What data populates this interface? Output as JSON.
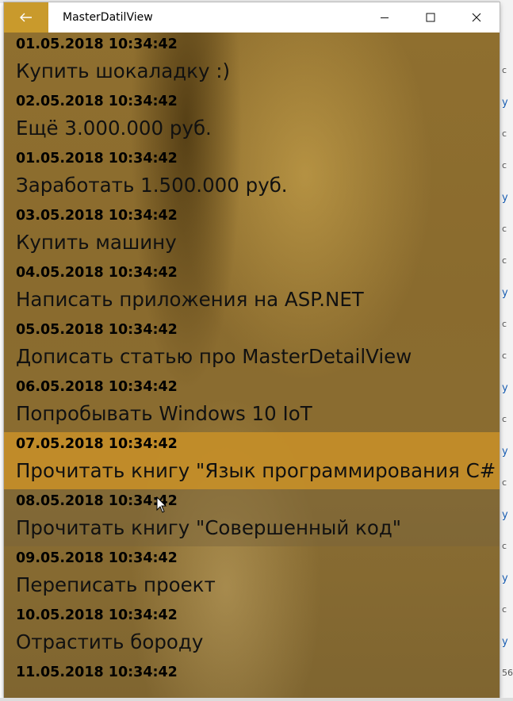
{
  "window": {
    "title": "MasterDatilView",
    "back_glyph": "←",
    "minimize_glyph": "—",
    "close_glyph": "✕"
  },
  "items": [
    {
      "date": "01.05.2018 10:34:42",
      "title": "Купить шокаладку :)"
    },
    {
      "date": "02.05.2018 10:34:42",
      "title": "Ещё 3.000.000 руб."
    },
    {
      "date": "01.05.2018 10:34:42",
      "title": "Заработать 1.500.000 руб."
    },
    {
      "date": "03.05.2018 10:34:42",
      "title": "Купить машину"
    },
    {
      "date": "04.05.2018 10:34:42",
      "title": "Написать приложения на ASP.NET"
    },
    {
      "date": "05.05.2018 10:34:42",
      "title": "Дописать статью про MasterDetailView"
    },
    {
      "date": "06.05.2018 10:34:42",
      "title": "Попробывать Windows 10 IoT"
    },
    {
      "date": "07.05.2018 10:34:42",
      "title": "Прочитать книгу \"Язык программирования C#"
    },
    {
      "date": "08.05.2018 10:34:42",
      "title": "Прочитать книгу \"Совершенный код\""
    },
    {
      "date": "09.05.2018 10:34:42",
      "title": "Переписать проект"
    },
    {
      "date": "10.05.2018 10:34:42",
      "title": "Отрастить бороду"
    },
    {
      "date": "11.05.2018 10:34:42",
      "title": ""
    }
  ],
  "selected_index": 7,
  "hovered_index": 8,
  "colors": {
    "accent": "#c99a2c",
    "selected_row": "#c48e28",
    "content_bg": "#8a6b2e"
  },
  "background_app": {
    "fragments": [
      "с",
      "у",
      "с",
      "с",
      "у",
      "с",
      "с",
      "у",
      "с",
      "с",
      "у",
      "с",
      "у",
      "с",
      "у",
      "с",
      "у",
      "с",
      "у",
      "56"
    ]
  }
}
